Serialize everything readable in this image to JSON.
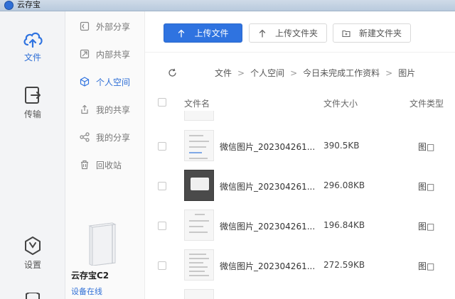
{
  "window": {
    "title": "云存宝"
  },
  "rail": {
    "items": [
      {
        "label": "文件",
        "icon": "cloud-icon",
        "active": true
      },
      {
        "label": "传输",
        "icon": "transfer-icon",
        "active": false
      },
      {
        "label": "设置",
        "icon": "settings-icon",
        "active": false
      }
    ]
  },
  "sidebar": {
    "items": [
      {
        "label": "外部分享",
        "icon": "external-share-icon"
      },
      {
        "label": "内部共享",
        "icon": "internal-share-icon"
      },
      {
        "label": "个人空间",
        "icon": "cube-icon",
        "active": true
      },
      {
        "label": "我的共享",
        "icon": "my-share-icon"
      },
      {
        "label": "我的分享",
        "icon": "share-nodes-icon"
      },
      {
        "label": "回收站",
        "icon": "trash-icon"
      }
    ],
    "device": {
      "name": "云存宝C2",
      "status": "设备在线"
    }
  },
  "toolbar": {
    "upload_file": "上传文件",
    "upload_folder": "上传文件夹",
    "new_folder": "新建文件夹"
  },
  "breadcrumb": {
    "items": [
      "文件",
      "个人空间",
      "今日未完成工作资料",
      "图片"
    ],
    "separator": ">"
  },
  "table": {
    "headers": {
      "name": "文件名",
      "size": "文件大小",
      "type": "文件类型"
    },
    "rows": [
      {
        "name": "微信图片_202304261...",
        "size": "390.5KB",
        "type": "图□"
      },
      {
        "name": "微信图片_202304261...",
        "size": "296.08KB",
        "type": "图□"
      },
      {
        "name": "微信图片_202304261...",
        "size": "196.84KB",
        "type": "图□"
      },
      {
        "name": "微信图片_202304261...",
        "size": "272.59KB",
        "type": "图□"
      }
    ]
  },
  "colors": {
    "accent": "#2f73e0",
    "rail_bg": "#f3f4f6",
    "sidebar_bg": "#fafafa"
  }
}
